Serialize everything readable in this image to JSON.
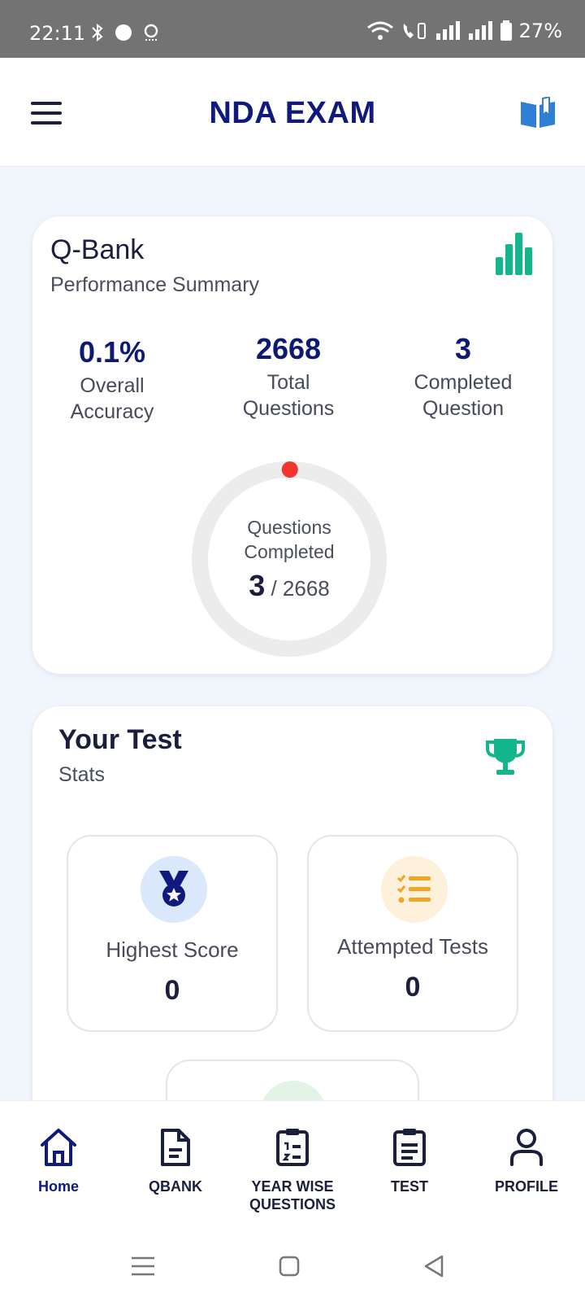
{
  "status_bar": {
    "time": "22:11",
    "battery": "27%",
    "left_icons": [
      "bluetooth-icon",
      "notification-icon",
      "app-icon"
    ],
    "right_icons": [
      "wifi-icon",
      "wifi-calling-icon",
      "signal-icon",
      "signal-icon",
      "battery-icon"
    ]
  },
  "header": {
    "title": "NDA EXAM",
    "menu_icon": "hamburger-menu-icon",
    "book_icon": "open-book-icon"
  },
  "qbank": {
    "title": "Q-Bank",
    "subtitle": "Performance Summary",
    "chart_icon": "bar-chart-icon",
    "stats": [
      {
        "value": "0.1%",
        "label_line1": "Overall",
        "label_line2": "Accuracy"
      },
      {
        "value": "2668",
        "label_line1": "Total",
        "label_line2": "Questions"
      },
      {
        "value": "3",
        "label_line1": "Completed",
        "label_line2": "Question"
      }
    ],
    "progress": {
      "label_line1": "Questions",
      "label_line2": "Completed",
      "completed": "3",
      "total": "/ 2668",
      "fraction": 0.0011
    }
  },
  "test": {
    "title": "Your Test",
    "subtitle": "Stats",
    "trophy_icon": "trophy-icon",
    "boxes": [
      {
        "label": "Highest Score",
        "value": "0",
        "icon": "medal-icon"
      },
      {
        "label": "Attempted Tests",
        "value": "0",
        "icon": "checklist-icon"
      }
    ]
  },
  "bottom_nav": {
    "items": [
      {
        "label": "Home",
        "icon": "home-icon",
        "active": true
      },
      {
        "label": "QBANK",
        "icon": "document-icon"
      },
      {
        "label_line1": "YEAR WISE",
        "label_line2": "QUESTIONS",
        "icon": "numbered-list-icon"
      },
      {
        "label": "TEST",
        "icon": "clipboard-icon"
      },
      {
        "label": "PROFILE",
        "icon": "user-icon"
      }
    ]
  },
  "colors": {
    "brand": "#101a7d",
    "accent_green": "#13b58c",
    "progress_dot": "#f2362f",
    "ring_track": "#ececec"
  }
}
